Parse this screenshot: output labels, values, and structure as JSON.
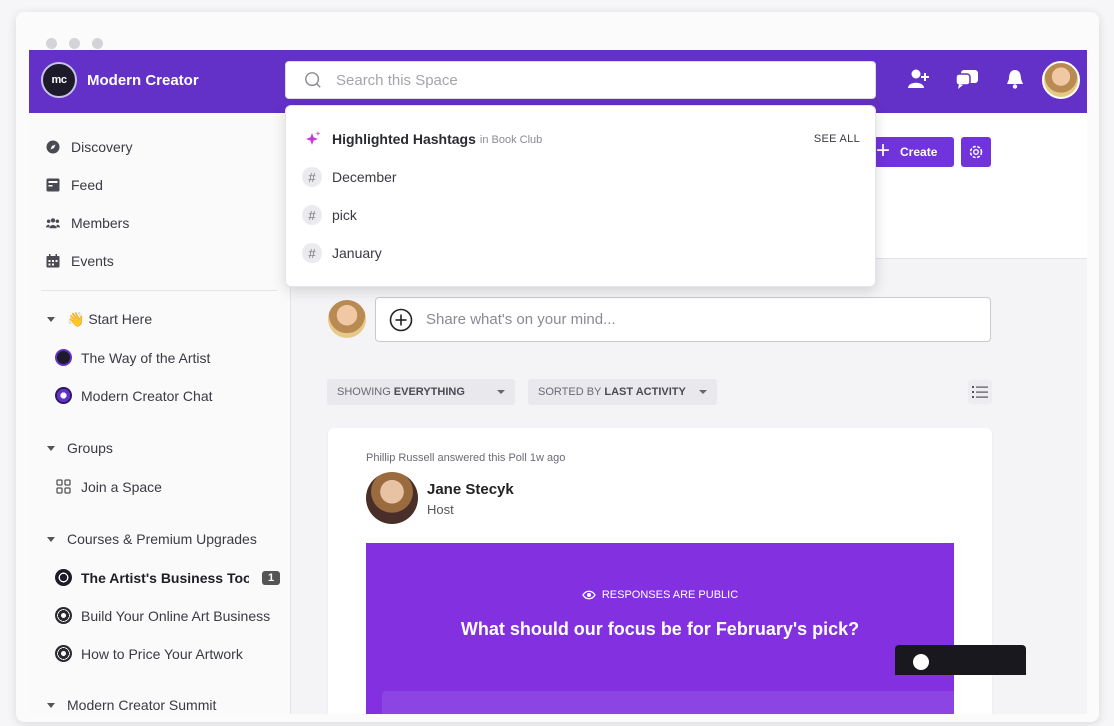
{
  "brand": {
    "logo_text": "mc",
    "name": "Modern Creator"
  },
  "search": {
    "placeholder": "Search this Space"
  },
  "sidebar": {
    "nav": [
      {
        "label": "Discovery",
        "icon": "compass-icon"
      },
      {
        "label": "Feed",
        "icon": "feed-icon"
      },
      {
        "label": "Members",
        "icon": "members-icon"
      },
      {
        "label": "Events",
        "icon": "calendar-icon"
      }
    ],
    "sections": [
      {
        "label": "👋 Start Here",
        "items": [
          "The Way of the Artist",
          "Modern Creator Chat"
        ]
      },
      {
        "label": "Groups",
        "items": [
          "Join a Space"
        ]
      },
      {
        "label": "Courses & Premium Upgrades",
        "items": [
          "The Artist's Business Tool",
          "Build Your Online Art Business",
          "How to Price Your Artwork"
        ]
      },
      {
        "label": "Modern Creator Summit",
        "items": []
      }
    ],
    "badge_count": "1"
  },
  "toolbar": {
    "create_label": "Create"
  },
  "composer": {
    "placeholder": "Share what's on your mind..."
  },
  "filters": {
    "showing_prefix": "SHOWING",
    "showing_value": "EVERYTHING",
    "sorted_prefix": "SORTED BY",
    "sorted_value": "LAST ACTIVITY"
  },
  "post": {
    "meta": "Phillip Russell answered this Poll 1w ago",
    "author": "Jane Stecyk",
    "role": "Host",
    "poll_visibility": "RESPONSES ARE PUBLIC",
    "poll_question": "What should our focus be for February's pick?"
  },
  "hashtags": {
    "title": "Highlighted Hashtags",
    "subtitle": "in Book Club",
    "see_all": "SEE ALL",
    "tags": [
      "December",
      "pick",
      "January"
    ]
  },
  "colors": {
    "brand": "#6330c8",
    "accent": "#7133dc",
    "poll": "#8331e0"
  }
}
